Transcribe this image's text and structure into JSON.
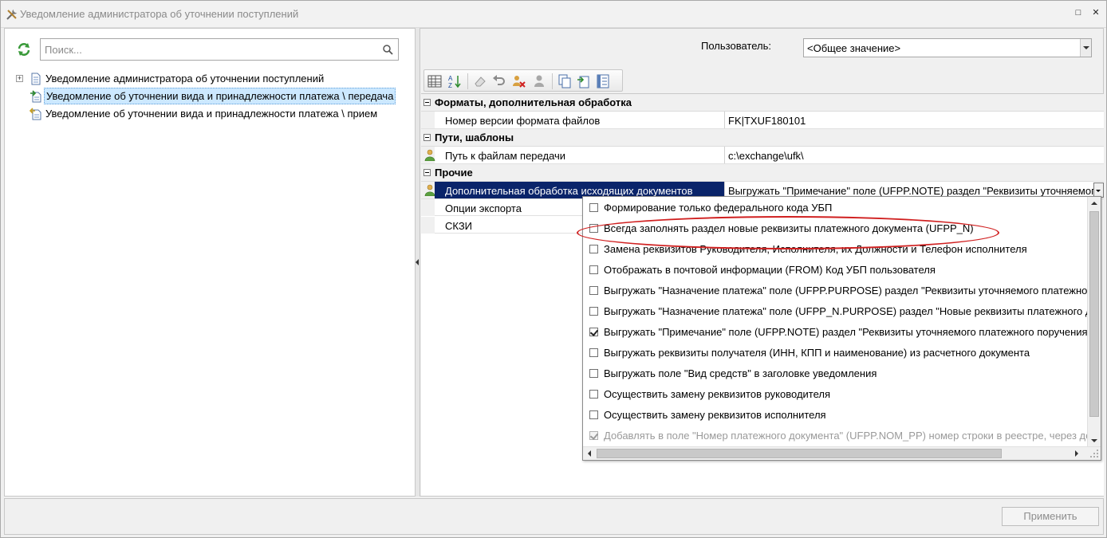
{
  "window": {
    "title": "Уведомление администратора об уточнении поступлений",
    "maximize_glyph": "□",
    "close_glyph": "✕"
  },
  "left": {
    "search_placeholder": "Поиск...",
    "tree": [
      {
        "label": "Уведомление администратора об уточнении поступлений",
        "expander": "+"
      },
      {
        "label": "Уведомление об уточнении вида и принадлежности платежа \\ передача",
        "selected": true
      },
      {
        "label": "Уведомление об уточнении вида и принадлежности платежа \\ прием"
      }
    ]
  },
  "right": {
    "user_label": "Пользователь:",
    "user_value": "<Общее значение>",
    "categories": [
      {
        "label": "Форматы, дополнительная обработка"
      },
      {
        "label": "Пути, шаблоны"
      },
      {
        "label": "Прочие"
      }
    ],
    "props": {
      "format_version": {
        "name": "Номер версии формата файлов",
        "value": "FK|TXUF180101"
      },
      "transfer_path": {
        "name": "Путь к файлам передачи",
        "value": "c:\\exchange\\ufk\\"
      },
      "extra_processing": {
        "name": "Дополнительная обработка исходящих документов",
        "value": "Выгружать \"Примечание\" поле (UFPP.NOTE) раздел \"Реквизиты уточняемого платежного поручения\""
      },
      "export_options": {
        "name": "Опции экспорта"
      },
      "skzi": {
        "name": "СКЗИ"
      }
    }
  },
  "popup": {
    "options": [
      {
        "label": "Формирование только федерального кода УБП",
        "checked": false
      },
      {
        "label": "Всегда заполнять раздел новые реквизиты  платежного документа (UFPP_N)",
        "checked": false
      },
      {
        "label": "Замена реквизитов Руководителя, Исполнителя, их Должности и Телефон исполнителя",
        "checked": false
      },
      {
        "label": "Отображать в почтовой информации (FROM) Код УБП пользователя",
        "checked": false
      },
      {
        "label": "Выгружать \"Назначение платежа\" поле (UFPP.PURPOSE) раздел \"Реквизиты уточняемого платежного поручения\"",
        "checked": false
      },
      {
        "label": "Выгружать \"Назначение платежа\" поле (UFPP_N.PURPOSE) раздел \"Новые реквизиты платежного документа\"",
        "checked": false
      },
      {
        "label": "Выгружать \"Примечание\" поле (UFPP.NOTE) раздел \"Реквизиты уточняемого платежного поручения\"",
        "checked": true
      },
      {
        "label": "Выгружать реквизиты получателя (ИНН, КПП и наименование) из расчетного документа",
        "checked": false
      },
      {
        "label": "Выгружать поле \"Вид средств\" в заголовке уведомления",
        "checked": false
      },
      {
        "label": "Осуществить замену реквизитов руководителя",
        "checked": false
      },
      {
        "label": "Осуществить замену реквизитов исполнителя",
        "checked": false
      },
      {
        "label": "Добавлять в поле \"Номер платежного документа\" (UFPP.NOM_PP) номер строки в реестре, через дефис",
        "checked": true,
        "disabled": true
      }
    ]
  },
  "footer": {
    "apply_label": "Применить"
  },
  "colors": {
    "selection_dark": "#0a246a",
    "selection_light": "#cce8ff",
    "highlight_ellipse": "#d02020"
  }
}
